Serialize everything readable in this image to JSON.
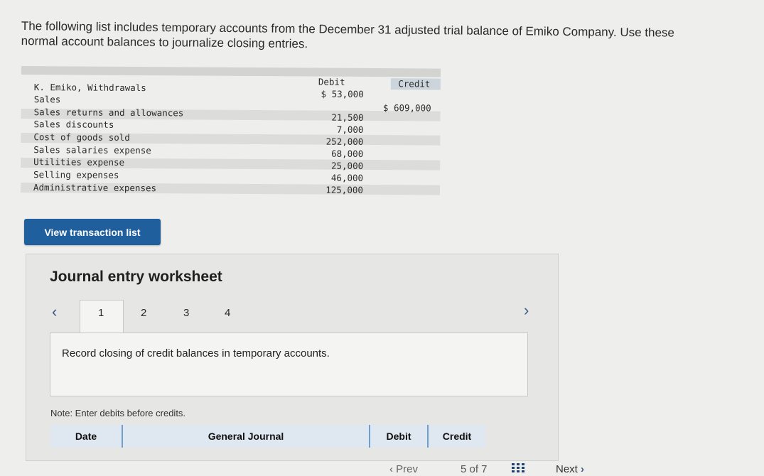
{
  "instructions": {
    "line1": "The following list includes temporary accounts from the December 31 adjusted trial balance of Emiko Company. Use these",
    "line2": "normal account balances to journalize closing entries."
  },
  "trial_balance": {
    "debit_header": "Debit",
    "credit_header": "Credit",
    "rows": [
      {
        "account": "K. Emiko, Withdrawals",
        "debit": "$ 53,000",
        "credit": ""
      },
      {
        "account": "Sales",
        "debit": "",
        "credit": "$ 609,000"
      },
      {
        "account": "Sales returns and allowances",
        "debit": "21,500",
        "credit": ""
      },
      {
        "account": "Sales discounts",
        "debit": "7,000",
        "credit": ""
      },
      {
        "account": "Cost of goods sold",
        "debit": "252,000",
        "credit": ""
      },
      {
        "account": "Sales salaries expense",
        "debit": "68,000",
        "credit": ""
      },
      {
        "account": "Utilities expense",
        "debit": "25,000",
        "credit": ""
      },
      {
        "account": "Selling expenses",
        "debit": "46,000",
        "credit": ""
      },
      {
        "account": "Administrative expenses",
        "debit": "125,000",
        "credit": ""
      }
    ]
  },
  "buttons": {
    "view_transaction_list": "View transaction list"
  },
  "worksheet": {
    "title": "Journal entry worksheet",
    "tabs": [
      "1",
      "2",
      "3",
      "4"
    ],
    "active_tab": "1",
    "instruction": "Record closing of credit balances in temporary accounts.",
    "note": "Note: Enter debits before credits.",
    "columns": {
      "date": "Date",
      "general_journal": "General Journal",
      "debit": "Debit",
      "credit": "Credit"
    }
  },
  "pagination": {
    "prev": "Prev",
    "page_info": "5 of 7",
    "next": "Next"
  },
  "icons": {
    "prev_tab": "chevron-left-icon",
    "next_tab": "chevron-right-icon",
    "grid": "grid-icon"
  },
  "colors": {
    "primary_button": "#1f5f9e",
    "table_header": "#6e9fcd"
  }
}
